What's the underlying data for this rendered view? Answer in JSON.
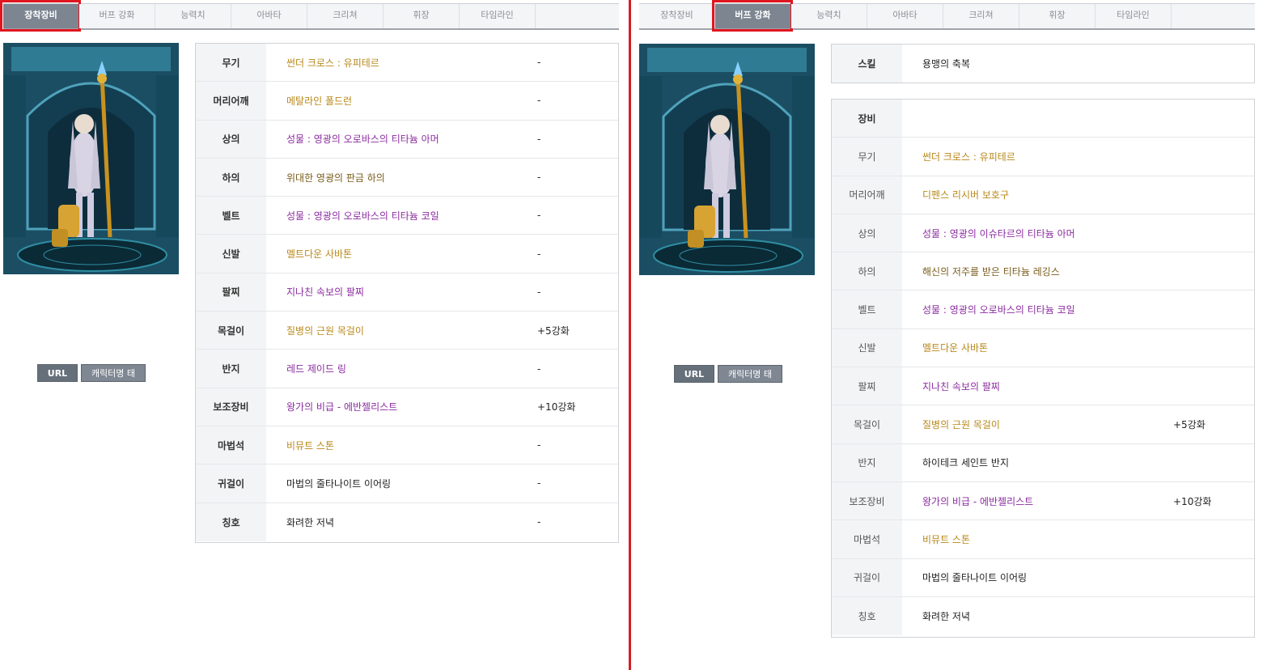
{
  "tabs": [
    "장착장비",
    "버프 강화",
    "능력치",
    "아바타",
    "크리쳐",
    "휘장",
    "타임라인"
  ],
  "buttons": {
    "url": "URL",
    "tag": "캐릭터명 태그"
  },
  "left": {
    "active_tab": "장착장비",
    "equipment": [
      {
        "slot": "무기",
        "item": "썬더 크로스 : 유피테르",
        "enhance": "-",
        "color": "gold"
      },
      {
        "slot": "머리어깨",
        "item": "메탈라인 폴드런",
        "enhance": "-",
        "color": "gold"
      },
      {
        "slot": "상의",
        "item": "성물 : 영광의 오로바스의 티타늄 아머",
        "enhance": "-",
        "color": "purple"
      },
      {
        "slot": "하의",
        "item": "위대한 영광의 판금 하의",
        "enhance": "-",
        "color": "brown"
      },
      {
        "slot": "벨트",
        "item": "성물 : 영광의 오로바스의 티타늄 코일",
        "enhance": "-",
        "color": "purple"
      },
      {
        "slot": "신발",
        "item": "멜트다운 사바톤",
        "enhance": "-",
        "color": "gold"
      },
      {
        "slot": "팔찌",
        "item": "지나친 속보의 팔찌",
        "enhance": "-",
        "color": "purple"
      },
      {
        "slot": "목걸이",
        "item": "질병의 근원 목걸이",
        "enhance": "+5강화",
        "color": "gold"
      },
      {
        "slot": "반지",
        "item": "레드 제이드 링",
        "enhance": "-",
        "color": "purple"
      },
      {
        "slot": "보조장비",
        "item": "왕가의 비급 - 에반젤리스트",
        "enhance": "+10강화",
        "color": "purple"
      },
      {
        "slot": "마법석",
        "item": "비뮤트 스톤",
        "enhance": "-",
        "color": "gold"
      },
      {
        "slot": "귀걸이",
        "item": "마법의 줄타나이트 이어링",
        "enhance": "-",
        "color": "plain"
      },
      {
        "slot": "칭호",
        "item": "화려한 저녁",
        "enhance": "-",
        "color": "plain"
      }
    ]
  },
  "right": {
    "active_tab": "버프 강화",
    "skill_label": "스킬",
    "skill_name": "용맹의 축복",
    "equip_header": "장비",
    "equipment": [
      {
        "slot": "무기",
        "item": "썬더 크로스 : 유피테르",
        "enhance": "",
        "color": "gold"
      },
      {
        "slot": "머리어깨",
        "item": "디펜스 리시버 보호구",
        "enhance": "",
        "color": "gold"
      },
      {
        "slot": "상의",
        "item": "성물 : 영광의 이슈타르의 티타늄 아머",
        "enhance": "",
        "color": "purple"
      },
      {
        "slot": "하의",
        "item": "해신의 저주를 받은 티타늄 레깅스",
        "enhance": "",
        "color": "brown"
      },
      {
        "slot": "벨트",
        "item": "성물 : 영광의 오로바스의 티타늄 코일",
        "enhance": "",
        "color": "purple"
      },
      {
        "slot": "신발",
        "item": "멜트다운 사바톤",
        "enhance": "",
        "color": "gold"
      },
      {
        "slot": "팔찌",
        "item": "지나친 속보의 팔찌",
        "enhance": "",
        "color": "purple"
      },
      {
        "slot": "목걸이",
        "item": "질병의 근원 목걸이",
        "enhance": "+5강화",
        "color": "gold"
      },
      {
        "slot": "반지",
        "item": "하이테크 세인트 반지",
        "enhance": "",
        "color": "plain"
      },
      {
        "slot": "보조장비",
        "item": "왕가의 비급 - 에반젤리스트",
        "enhance": "+10강화",
        "color": "purple"
      },
      {
        "slot": "마법석",
        "item": "비뮤트 스톤",
        "enhance": "",
        "color": "gold"
      },
      {
        "slot": "귀걸이",
        "item": "마법의 줄타나이트 이어링",
        "enhance": "",
        "color": "plain"
      },
      {
        "slot": "칭호",
        "item": "화려한 저녁",
        "enhance": "",
        "color": "plain"
      }
    ]
  }
}
